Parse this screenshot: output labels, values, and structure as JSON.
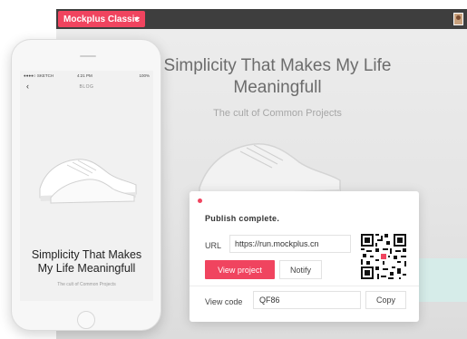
{
  "app": {
    "brand_label": "Mockplus Classic"
  },
  "hero": {
    "title": "Simplicity That Makes My Life Meaningfull",
    "subtitle": "The cult of Common Projects"
  },
  "phone": {
    "status": {
      "carrier": "●●●●○ SKETCH ",
      "time": "4:21 PM",
      "battery": "100%"
    },
    "nav_title": "BLOG",
    "back_icon": "chevron-left-icon",
    "title": "Simplicity That Makes My Life Meaningfull",
    "subtitle": "The cult of Common Projects"
  },
  "publish": {
    "title": "Publish complete.",
    "url_label": "URL",
    "url_value": "https://run.mockplus.cn",
    "view_button": "View project",
    "notify_button": "Notify",
    "view_code_label": "View code",
    "view_code_value": "QF86",
    "copy_button": "Copy"
  },
  "colors": {
    "accent": "#f0445f",
    "topbar": "#3e3e3e",
    "teal": "#d6ece9"
  }
}
